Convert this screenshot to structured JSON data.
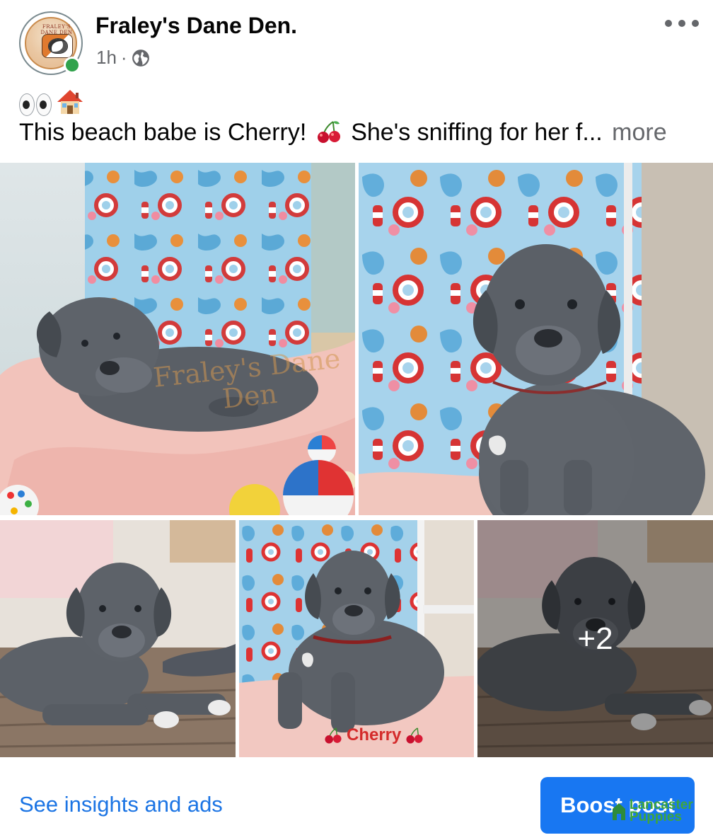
{
  "header": {
    "page_name": "Fraley's Dane Den.",
    "time": "1h",
    "separator": "·",
    "privacy_icon": "globe-icon",
    "more_icon": "more-horizontal-icon",
    "avatar_text": "FRALEY'S DANE DEN",
    "online_color": "#31a24c"
  },
  "post": {
    "emoji_line": [
      "eyes-emoji",
      "house-emoji"
    ],
    "caption_before": "This beach babe is Cherry!",
    "caption_after": "She's sniffing for her f...",
    "more_label": "more"
  },
  "photos": {
    "watermark": "Fraley's Dane Den",
    "extra_count": "+2",
    "cherry_label": "Cherry"
  },
  "footer": {
    "insights_label": "See insights and ads",
    "boost_label": "Boost post",
    "overlay_logo_line1": "Lancaster",
    "overlay_logo_line2": "Puppies"
  },
  "colors": {
    "link": "#1b74e4",
    "button": "#1877f2",
    "secondary_text": "#65676b"
  }
}
